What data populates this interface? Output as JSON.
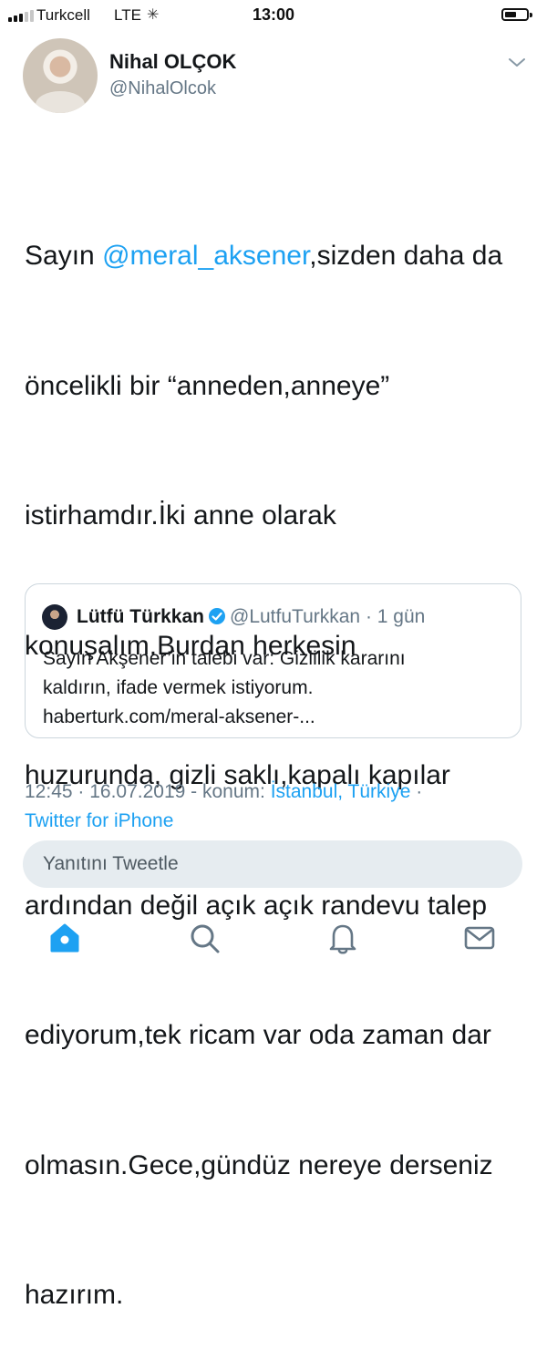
{
  "status_bar": {
    "carrier": "Turkcell",
    "network": "LTE",
    "loading_glyph": "✳",
    "time": "13:00"
  },
  "author": {
    "name": "Nihal OLÇOK",
    "handle": "@NihalOlcok",
    "avatar_icon": "profile-photo"
  },
  "tweet": {
    "lines": [
      {
        "before": "Sayın ",
        "mention": "@meral_aksener",
        "after": ",sizden daha da"
      },
      {
        "text": "öncelikli bir “anneden,anneye”"
      },
      {
        "text": "istirhamdır.İki anne olarak"
      },
      {
        "text": "konuşalım.Burdan herkesin"
      },
      {
        "text": "huzurunda, gizli saklı,kapalı kapılar"
      },
      {
        "text": "ardından değil açık açık randevu talep"
      },
      {
        "text": "ediyorum,tek ricam var oda zaman dar"
      },
      {
        "text": "olmasın.Gece,gündüz nereye derseniz"
      },
      {
        "text": "hazırım."
      }
    ],
    "mention_color": "#1da1f2"
  },
  "quoted_tweet": {
    "name": "Lütfü Türkkan",
    "handle": "@LutfuTurkkan",
    "age": "· 1 gün",
    "text_lines": [
      "Sayın Akşener’in talebi var: Gizlilik kararını",
      "kaldırın, ifade vermek istiyorum.",
      "haberturk.com/meral-aksener-..."
    ]
  },
  "meta": {
    "time_date": "12:45 · 16.07.2019 - konum: ",
    "location": "İstanbul, Türkiye",
    "separator": " ·",
    "source": "Twitter for iPhone"
  },
  "reply": {
    "placeholder": "Yanıtını Tweetle"
  },
  "tab_bar": {
    "items": [
      "home-icon",
      "search-icon",
      "notifications-icon",
      "messages-icon"
    ],
    "active": "home-icon",
    "active_color": "#1da1f2",
    "inactive_color": "#657786"
  },
  "colors": {
    "accent": "#1da1f2",
    "secondary_text": "#657786",
    "border": "#ccd6dd",
    "reply_bg": "#e6ecf0"
  }
}
